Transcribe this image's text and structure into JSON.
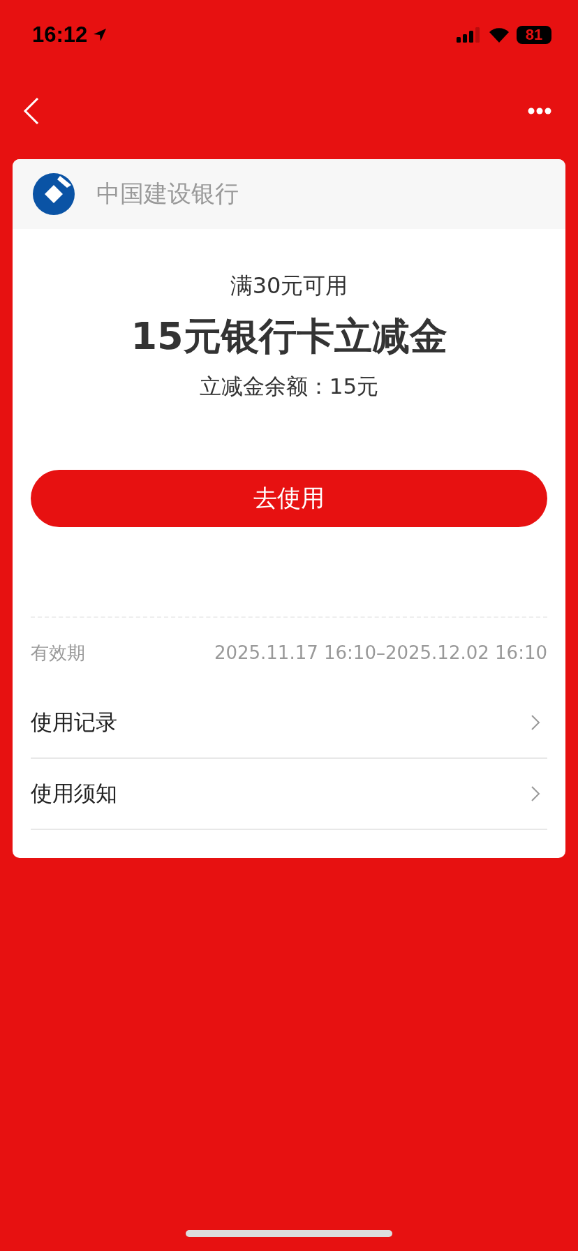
{
  "status_bar": {
    "time": "16:12",
    "battery": "81"
  },
  "coupon": {
    "bank": "中国建设银行",
    "condition": "满30元可用",
    "title": "15元银行卡立减金",
    "balance": "立减金余额：15元",
    "button": "去使用",
    "validity": {
      "label": "有效期",
      "value": "2025.11.17 16:10–2025.12.02 16:10"
    },
    "links": [
      {
        "label": "使用记录"
      },
      {
        "label": "使用须知"
      }
    ]
  }
}
